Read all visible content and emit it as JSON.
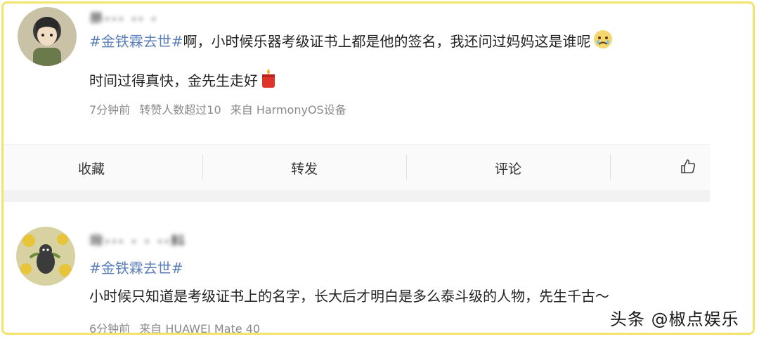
{
  "post1": {
    "username": "是··· ·· ·",
    "hashtag": "#金铁霖去世#",
    "line1_rest": "啊，小时候乐器考级证书上都是他的签名，我还问过妈妈这是谁呢",
    "line2": "时间过得真快，金先生走好",
    "meta_time": "7分钟前",
    "meta_reposts": "转赞人数超过10",
    "meta_source": "来自 HarmonyOS设备",
    "emoji1": "sad-face-emoji",
    "emoji2": "candle-emoji"
  },
  "actions": {
    "collect": "收藏",
    "repost": "转发",
    "comment": "评论",
    "like_icon": "thumbs-up-icon"
  },
  "post2": {
    "username": "我··· · · ··料",
    "hashtag": "#金铁霖去世#",
    "line2": "小时候只知道是考级证书上的名字，长大后才明白是多么泰斗级的人物，先生千古～",
    "meta_time": "6分钟前",
    "meta_source": "来自 HUAWEI Mate 40"
  },
  "watermark": "头条 @椒点娱乐",
  "colors": {
    "hashtag": "#5b7fb8",
    "frame": "#f2e36a",
    "meta": "#8a8a8a"
  }
}
